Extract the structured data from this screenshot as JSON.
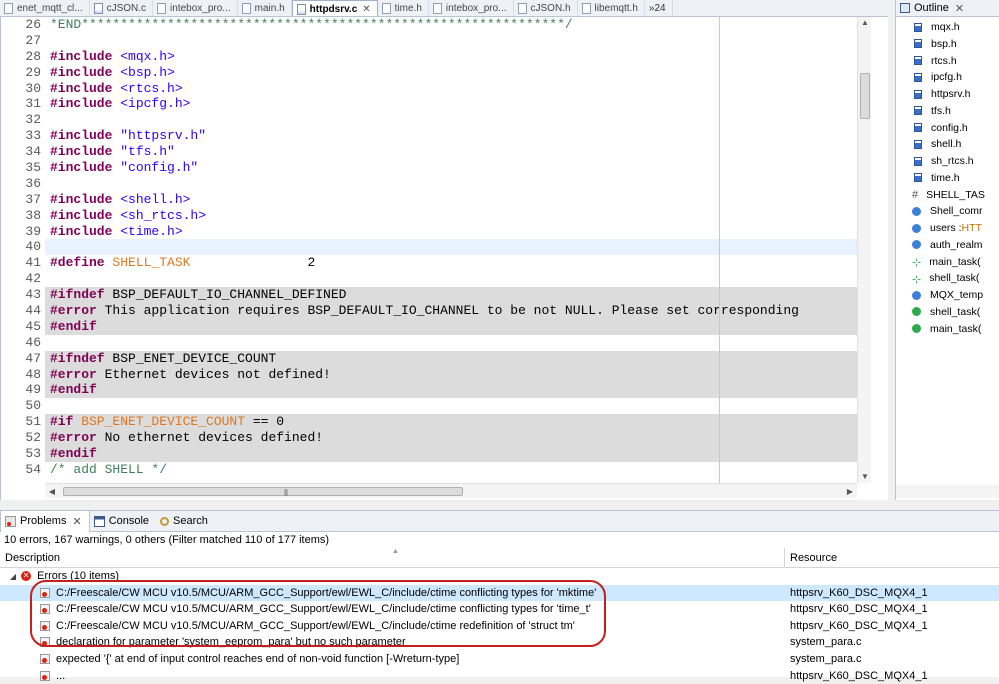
{
  "editor_tabs": [
    {
      "label": "enet_mqtt_cl...",
      "active": false
    },
    {
      "label": "cJSON.c",
      "active": false
    },
    {
      "label": "intebox_pro...",
      "active": false
    },
    {
      "label": "main.h",
      "active": false
    },
    {
      "label": "httpdsrv.c",
      "active": true,
      "close": "✕"
    },
    {
      "label": "time.h",
      "active": false
    },
    {
      "label": "intebox_pro...",
      "active": false
    },
    {
      "label": "cJSON.h",
      "active": false
    },
    {
      "label": "libemqtt.h",
      "active": false
    }
  ],
  "editor_overflow_label": "»24",
  "code_lines": [
    {
      "n": "26",
      "text": "*END**************************************************************/",
      "style": "cmt",
      "hl": ""
    },
    {
      "n": "27",
      "text": "",
      "style": "plain",
      "hl": ""
    },
    {
      "n": "28",
      "dir": "#include",
      "rest": " <mqx.h>",
      "rest_style": "str",
      "hl": ""
    },
    {
      "n": "29",
      "dir": "#include",
      "rest": " <bsp.h>",
      "rest_style": "str",
      "hl": ""
    },
    {
      "n": "30",
      "dir": "#include",
      "rest": " <rtcs.h>",
      "rest_style": "str",
      "hl": ""
    },
    {
      "n": "31",
      "dir": "#include",
      "rest": " <ipcfg.h>",
      "rest_style": "str",
      "hl": ""
    },
    {
      "n": "32",
      "text": "",
      "style": "plain",
      "hl": ""
    },
    {
      "n": "33",
      "dir": "#include",
      "rest": " \"httpsrv.h\"",
      "rest_style": "str",
      "hl": ""
    },
    {
      "n": "34",
      "dir": "#include",
      "rest": " \"tfs.h\"",
      "rest_style": "str",
      "hl": ""
    },
    {
      "n": "35",
      "dir": "#include",
      "rest": " \"config.h\"",
      "rest_style": "str",
      "hl": ""
    },
    {
      "n": "36",
      "text": "",
      "style": "plain",
      "hl": ""
    },
    {
      "n": "37",
      "dir": "#include",
      "rest": " <shell.h>",
      "rest_style": "str",
      "hl": ""
    },
    {
      "n": "38",
      "dir": "#include",
      "rest": " <sh_rtcs.h>",
      "rest_style": "str",
      "hl": ""
    },
    {
      "n": "39",
      "dir": "#include",
      "rest": " <time.h>",
      "rest_style": "str",
      "hl": ""
    },
    {
      "n": "40",
      "text": "",
      "style": "plain",
      "hl": "cur"
    },
    {
      "n": "41",
      "dir": "#define",
      "mac": " SHELL_TASK",
      "rest": "               2",
      "rest_style": "plain",
      "hl": ""
    },
    {
      "n": "42",
      "text": "",
      "style": "plain",
      "hl": ""
    },
    {
      "n": "43",
      "dir": "#ifndef",
      "rest": " BSP_DEFAULT_IO_CHANNEL_DEFINED",
      "rest_style": "plain",
      "hl": "inactive"
    },
    {
      "n": "44",
      "dir": "#error",
      "rest": " This application requires BSP_DEFAULT_IO_CHANNEL to be not NULL. Please set corresponding",
      "rest_style": "plain",
      "hl": "inactive"
    },
    {
      "n": "45",
      "dir": "#endif",
      "rest": "",
      "rest_style": "plain",
      "hl": "inactive"
    },
    {
      "n": "46",
      "text": "",
      "style": "plain",
      "hl": ""
    },
    {
      "n": "47",
      "dir": "#ifndef",
      "rest": " BSP_ENET_DEVICE_COUNT",
      "rest_style": "plain",
      "hl": "inactive"
    },
    {
      "n": "48",
      "dir": "#error",
      "rest": " Ethernet devices not defined!",
      "rest_style": "plain",
      "hl": "inactive"
    },
    {
      "n": "49",
      "dir": "#endif",
      "rest": "",
      "rest_style": "plain",
      "hl": "inactive"
    },
    {
      "n": "50",
      "text": "",
      "style": "plain",
      "hl": ""
    },
    {
      "n": "51",
      "dir": "#if",
      "mac": " BSP_ENET_DEVICE_COUNT",
      "rest": " == 0",
      "rest_style": "plain",
      "hl": "inactive"
    },
    {
      "n": "52",
      "dir": "#error",
      "rest": " No ethernet devices defined!",
      "rest_style": "plain",
      "hl": "inactive"
    },
    {
      "n": "53",
      "dir": "#endif",
      "rest": "",
      "rest_style": "plain",
      "hl": "inactive"
    },
    {
      "n": "54",
      "text": "/* add SHELL */",
      "style": "cmt",
      "hl": ""
    }
  ],
  "outline": {
    "tab_label": "Outline",
    "close": "✕",
    "items": [
      {
        "label": "mqx.h",
        "icon": "include-icon"
      },
      {
        "label": "bsp.h",
        "icon": "include-icon"
      },
      {
        "label": "rtcs.h",
        "icon": "include-icon"
      },
      {
        "label": "ipcfg.h",
        "icon": "include-icon"
      },
      {
        "label": "httpsrv.h",
        "icon": "include-icon"
      },
      {
        "label": "tfs.h",
        "icon": "include-icon"
      },
      {
        "label": "config.h",
        "icon": "include-icon"
      },
      {
        "label": "shell.h",
        "icon": "include-icon"
      },
      {
        "label": "sh_rtcs.h",
        "icon": "include-icon"
      },
      {
        "label": "time.h",
        "icon": "include-icon"
      },
      {
        "label": "SHELL_TAS",
        "icon": "macro-icon"
      },
      {
        "label": "Shell_comr",
        "icon": "variable-icon"
      },
      {
        "label": "users : ",
        "suffix": "HTT",
        "icon": "variable-icon"
      },
      {
        "label": "auth_realm",
        "icon": "variable-icon"
      },
      {
        "label": "main_task(",
        "icon": "function-prototype-icon"
      },
      {
        "label": "shell_task(",
        "icon": "function-prototype-icon"
      },
      {
        "label": "MQX_temp",
        "icon": "variable-icon"
      },
      {
        "label": "shell_task(",
        "icon": "function-icon"
      },
      {
        "label": "main_task(",
        "icon": "function-icon"
      }
    ]
  },
  "bottom": {
    "tabs": [
      {
        "label": "Problems",
        "icon": "problems-icon",
        "active": true
      },
      {
        "label": "Console",
        "icon": "console-icon",
        "active": false
      },
      {
        "label": "Search",
        "icon": "search-icon",
        "active": false
      }
    ],
    "close": "✕",
    "summary": "10 errors, 167 warnings, 0 others (Filter matched 110 of 177 items)",
    "columns": {
      "description": "Description",
      "resource": "Resource"
    },
    "group_label": "Errors (10 items)",
    "rows": [
      {
        "desc": "C:/Freescale/CW MCU v10.5/MCU/ARM_GCC_Support/ewl/EWL_C/include/ctime conflicting types for 'mktime'",
        "res": "httpsrv_K60_DSC_MQX4_1",
        "selected": true
      },
      {
        "desc": "C:/Freescale/CW MCU v10.5/MCU/ARM_GCC_Support/ewl/EWL_C/include/ctime conflicting types for 'time_t'",
        "res": "httpsrv_K60_DSC_MQX4_1",
        "selected": false
      },
      {
        "desc": "C:/Freescale/CW MCU v10.5/MCU/ARM_GCC_Support/ewl/EWL_C/include/ctime redefinition of 'struct tm'",
        "res": "httpsrv_K60_DSC_MQX4_1",
        "selected": false
      },
      {
        "desc": "declaration for parameter 'system_eeprom_para' but no such parameter",
        "res": "system_para.c",
        "selected": false
      },
      {
        "desc": "expected '{' at end of input control reaches end of non-void function [-Wreturn-type]",
        "res": "system_para.c",
        "selected": false
      },
      {
        "desc": "...",
        "res": "httpsrv_K60_DSC_MQX4_1",
        "selected": false
      }
    ]
  },
  "colors": {
    "annotation_oval": "#c32020",
    "selection": "#cde8ff",
    "inactive_code": "#dcdcdc",
    "directive": "#7f0055",
    "string": "#2a00ff",
    "macro": "#e0771f",
    "comment": "#3f7f5f"
  }
}
